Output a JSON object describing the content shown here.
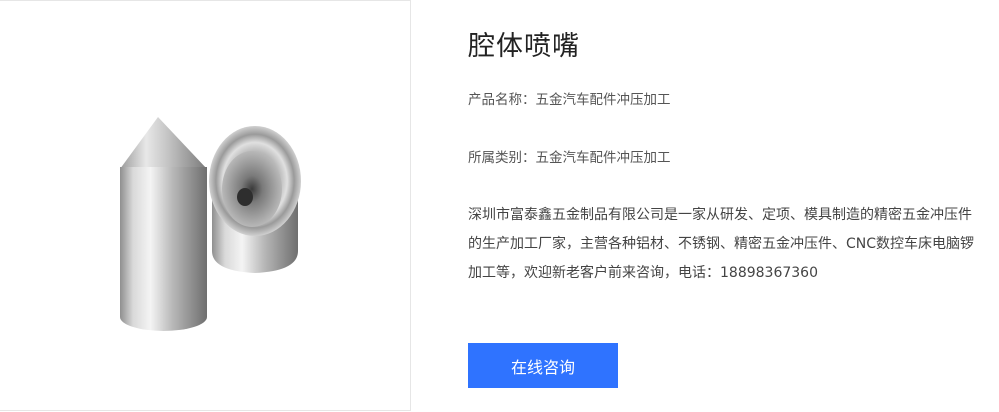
{
  "product": {
    "title": "腔体喷嘴",
    "name_label": "产品名称：",
    "name_value": "五金汽车配件冲压加工",
    "category_label": "所属类别：",
    "category_value": "五金汽车配件冲压加工",
    "description": "深圳市富泰鑫五金制品有限公司是一家从研发、定项、模具制造的精密五金冲压件的生产加工厂家，主营各种铝材、不锈钢、精密五金冲压件、CNC数控车床电脑锣加工等，欢迎新老客户前来咨询，电话：18898367360",
    "consult_button": "在线咨询"
  },
  "colors": {
    "button_bg": "#2f73ff",
    "button_text": "#ffffff"
  }
}
